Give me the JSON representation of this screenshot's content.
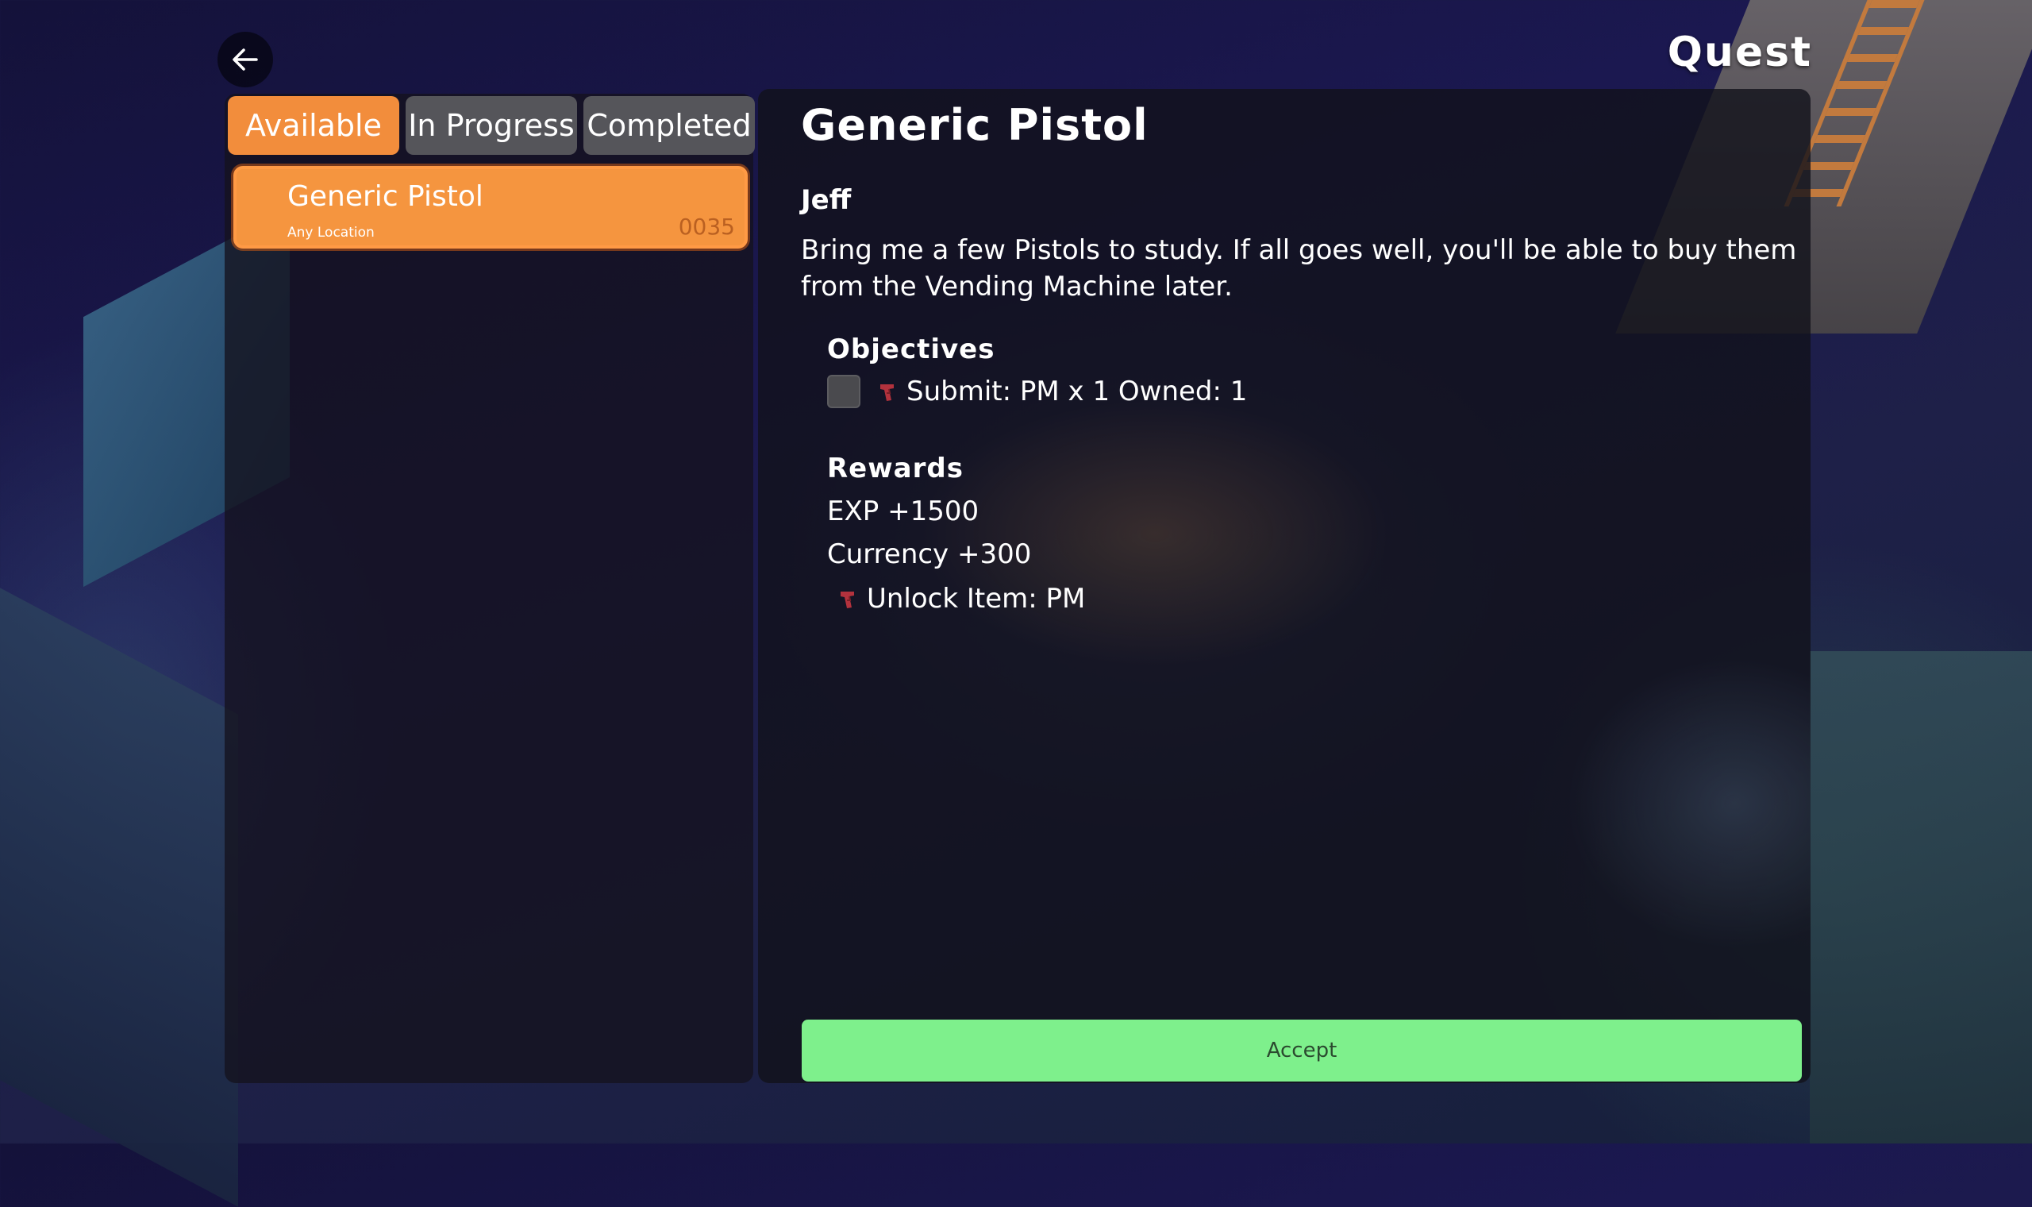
{
  "header": {
    "title": "Quest"
  },
  "tabs": [
    {
      "label": "Available",
      "active": true
    },
    {
      "label": "In Progress",
      "active": false
    },
    {
      "label": "Completed",
      "active": false
    }
  ],
  "quest_list": [
    {
      "name": "Generic Pistol",
      "location": "Any Location",
      "code": "0035",
      "selected": true
    }
  ],
  "detail": {
    "title": "Generic Pistol",
    "giver": "Jeff",
    "description": "Bring me a few Pistols to study. If all goes well, you'll be able to buy them from the Vending Machine later.",
    "objectives_heading": "Objectives",
    "objectives": [
      {
        "text": "Submit: PM x 1 Owned: 1",
        "icon": "pistol-icon",
        "checked": false
      }
    ],
    "rewards_heading": "Rewards",
    "rewards": {
      "exp": "EXP +1500",
      "currency": "Currency +300",
      "unlock": "Unlock Item: PM",
      "unlock_icon": "pistol-icon"
    },
    "accept_label": "Accept"
  },
  "colors": {
    "tab_active": "#f28d3c",
    "tab_inactive": "#55555a",
    "quest_selected": "#f5953f",
    "accept": "#7ef08c"
  }
}
